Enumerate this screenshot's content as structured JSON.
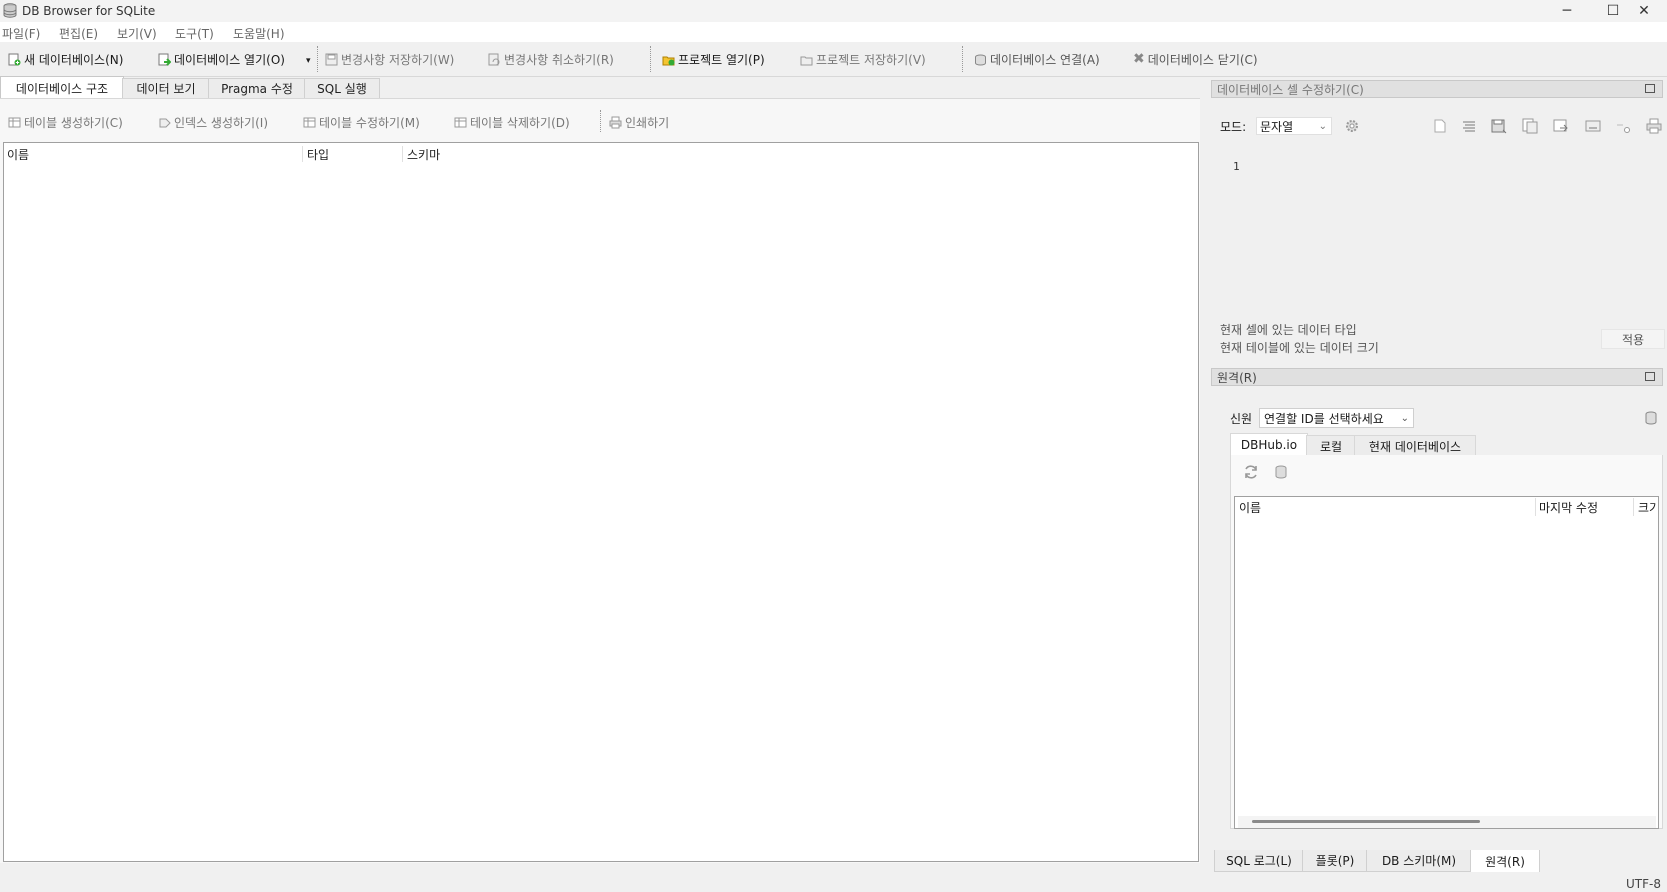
{
  "window": {
    "title": "DB Browser for SQLite",
    "controls": [
      "─",
      "☐",
      "✕"
    ]
  },
  "menu": [
    "파일(F)",
    "편집(E)",
    "보기(V)",
    "도구(T)",
    "도움말(H)"
  ],
  "toolbar": {
    "new_db": "새 데이터베이스(N)",
    "open_db": "데이터베이스 열기(O)",
    "write_changes": "변경사항 저장하기(W)",
    "revert_changes": "변경사항 취소하기(R)",
    "open_project": "프로젝트 열기(P)",
    "save_project": "프로젝트 저장하기(V)",
    "attach_db": "데이터베이스 연결(A)",
    "close_db": "데이터베이스 닫기(C)"
  },
  "main_tabs": [
    "데이터베이스 구조",
    "데이터 보기",
    "Pragma 수정",
    "SQL 실행"
  ],
  "structure_toolbar": {
    "create_table": "테이블 생성하기(C)",
    "create_index": "인덱스 생성하기(I)",
    "modify_table": "테이블 수정하기(M)",
    "delete_table": "테이블 삭제하기(D)",
    "print": "인쇄하기"
  },
  "structure_columns": [
    "이름",
    "타입",
    "스키마"
  ],
  "edit_cell": {
    "title": "데이터베이스 셀 수정하기(C)",
    "mode_label": "모드:",
    "mode_value": "문자열",
    "line_number": "1",
    "type_info": "현재 셀에 있는 데이터 타입",
    "size_info": "현재 테이블에 있는 데이터 크기",
    "apply": "적용"
  },
  "remote": {
    "title": "원격(R)",
    "identity_label": "신원",
    "identity_placeholder": "연결할 ID를 선택하세요",
    "tabs": [
      "DBHub.io",
      "로컬",
      "현재 데이터베이스"
    ],
    "columns": [
      "이름",
      "마지막 수정",
      "크기"
    ]
  },
  "bottom_tabs": [
    "SQL 로그(L)",
    "플롯(P)",
    "DB 스키마(M)",
    "원격(R)"
  ],
  "status": {
    "encoding": "UTF-8"
  }
}
